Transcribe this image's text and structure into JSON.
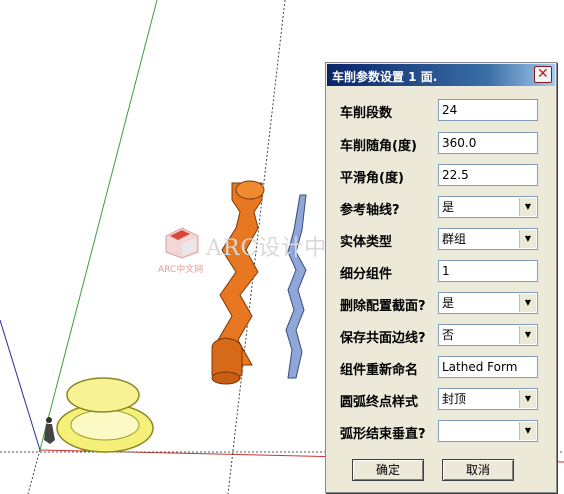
{
  "watermark": {
    "text": "ARC设计中文网",
    "subtext": "ARC中文网"
  },
  "dialog": {
    "title": "车削参数设置 1 面.",
    "fields": [
      {
        "label": "车削段数",
        "value": "24",
        "type": "text"
      },
      {
        "label": "车削随角(度)",
        "value": "360.0",
        "type": "text"
      },
      {
        "label": "平滑角(度)",
        "value": "22.5",
        "type": "text"
      },
      {
        "label": "参考轴线?",
        "value": "是",
        "type": "select"
      },
      {
        "label": "实体类型",
        "value": "群组",
        "type": "select"
      },
      {
        "label": "细分组件",
        "value": "1",
        "type": "text"
      },
      {
        "label": "删除配置截面?",
        "value": "是",
        "type": "select"
      },
      {
        "label": "保存共面边线?",
        "value": "否",
        "type": "select"
      },
      {
        "label": "组件重新命名",
        "value": "Lathed Form",
        "type": "text"
      },
      {
        "label": "圆弧终点样式",
        "value": "封顶",
        "type": "select"
      },
      {
        "label": "弧形结束垂直?",
        "value": "",
        "type": "select"
      }
    ],
    "ok_label": "确定",
    "cancel_label": "取消"
  },
  "colors": {
    "title_gradient_start": "#0a246a",
    "dialog_bg": "#ece9d8",
    "lathe_orange": "#e87722",
    "disc_yellow": "#f4f07a",
    "profile_blue": "#8ea6d8"
  },
  "icons": [
    "close-icon",
    "dropdown-arrow-icon",
    "person-icon",
    "arc-logo-icon"
  ]
}
